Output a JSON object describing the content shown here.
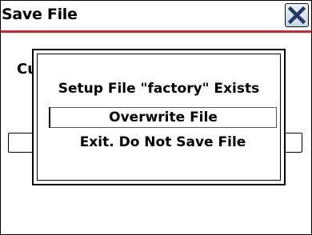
{
  "window": {
    "title": "Save File",
    "close_icon": "close-x-icon",
    "accent_color": "#cc2b2b"
  },
  "background": {
    "label_fragment": "Cu"
  },
  "dialog": {
    "message": "Setup File \"factory\" Exists",
    "options": [
      {
        "label": "Overwrite File",
        "selected": true
      },
      {
        "label": "Exit. Do Not Save File",
        "selected": false
      }
    ]
  }
}
